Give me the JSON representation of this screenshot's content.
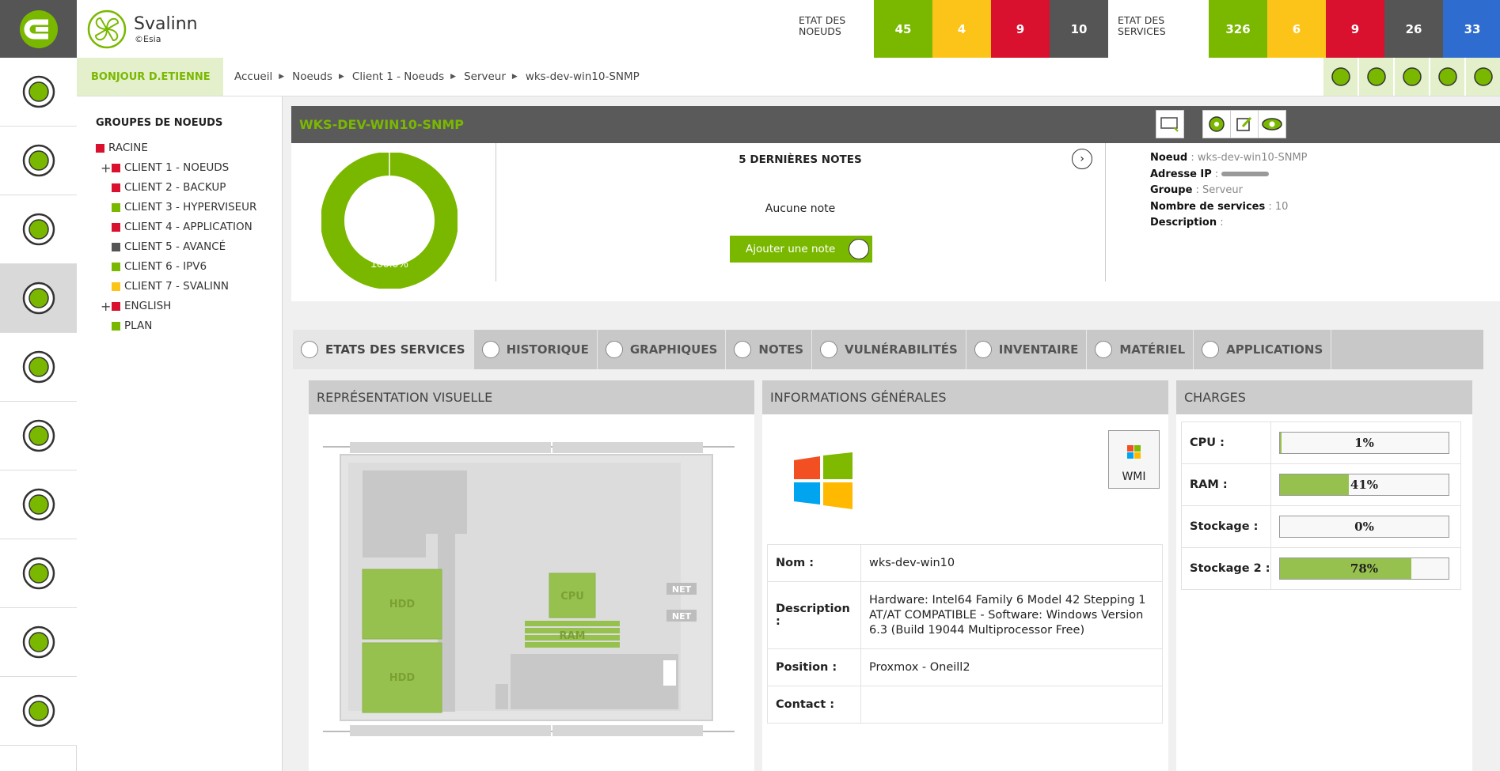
{
  "brand": {
    "name": "Svalinn",
    "sub": "©Esia"
  },
  "node_status": {
    "label": "ETAT DES NOEUDS",
    "counts": [
      {
        "value": "45",
        "color": "#7ab800"
      },
      {
        "value": "4",
        "color": "#fcc419"
      },
      {
        "value": "9",
        "color": "#d9102e"
      },
      {
        "value": "10",
        "color": "#555555"
      }
    ]
  },
  "service_status": {
    "label": "ETAT DES SERVICES",
    "counts": [
      {
        "value": "326",
        "color": "#7ab800"
      },
      {
        "value": "6",
        "color": "#fcc419"
      },
      {
        "value": "9",
        "color": "#d9102e"
      },
      {
        "value": "26",
        "color": "#555555"
      },
      {
        "value": "33",
        "color": "#2f6ccf"
      }
    ]
  },
  "greeting": "BONJOUR D.ETIENNE",
  "breadcrumb": [
    "Accueil",
    "Noeuds",
    "Client 1 - Noeuds",
    "Serveur",
    "wks-dev-win10-SNMP"
  ],
  "toolbar_icons": [
    "user-icon",
    "rss-icon",
    "search-icon",
    "help-icon",
    "lock-icon"
  ],
  "left_nav": [
    "dashboard-icon",
    "alert-icon",
    "history-icon",
    "share-nodes-icon",
    "report-icon",
    "satellite-icon",
    "security-icon",
    "workflow-icon",
    "layers-icon",
    "settings-icon"
  ],
  "groups": {
    "title": "GROUPES DE NOEUDS",
    "items": [
      {
        "label": "RACINE",
        "color": "#d9102e",
        "indent": 0,
        "expand": ""
      },
      {
        "label": "CLIENT 1 - NOEUDS",
        "color": "#d9102e",
        "indent": 1,
        "expand": "+"
      },
      {
        "label": "CLIENT 2 - BACKUP",
        "color": "#d9102e",
        "indent": 1,
        "expand": ""
      },
      {
        "label": "CLIENT 3 - HYPERVISEUR",
        "color": "#7ab800",
        "indent": 1,
        "expand": ""
      },
      {
        "label": "CLIENT 4 - APPLICATION",
        "color": "#d9102e",
        "indent": 1,
        "expand": ""
      },
      {
        "label": "CLIENT 5 - AVANCÉ",
        "color": "#555555",
        "indent": 1,
        "expand": ""
      },
      {
        "label": "CLIENT 6 - IPV6",
        "color": "#7ab800",
        "indent": 1,
        "expand": ""
      },
      {
        "label": "CLIENT 7 - SVALINN",
        "color": "#fcc419",
        "indent": 1,
        "expand": ""
      },
      {
        "label": "ENGLISH",
        "color": "#d9102e",
        "indent": 1,
        "expand": "+"
      },
      {
        "label": "PLAN",
        "color": "#7ab800",
        "indent": 1,
        "expand": ""
      }
    ]
  },
  "node": {
    "title": "WKS-DEV-WIN10-SNMP",
    "availability": 100.0,
    "availability_label": "100.0%",
    "notes_title": "5 DERNIÈRES NOTES",
    "notes_empty": "Aucune note",
    "add_note": "Ajouter une note",
    "info": [
      {
        "key": "Noeud",
        "value": "wks-dev-win10-SNMP"
      },
      {
        "key": "Adresse IP",
        "value": ""
      },
      {
        "key": "Groupe",
        "value": "Serveur"
      },
      {
        "key": "Nombre de services",
        "value": "10"
      },
      {
        "key": "Description",
        "value": ""
      }
    ]
  },
  "tabs": [
    {
      "label": "ETATS DES SERVICES",
      "active": true
    },
    {
      "label": "HISTORIQUE",
      "active": false
    },
    {
      "label": "GRAPHIQUES",
      "active": false
    },
    {
      "label": "NOTES",
      "active": false
    },
    {
      "label": "VULNÉRABILITÉS",
      "active": false
    },
    {
      "label": "INVENTAIRE",
      "active": false
    },
    {
      "label": "MATÉRIEL",
      "active": false
    },
    {
      "label": "APPLICATIONS",
      "active": false
    }
  ],
  "visual": {
    "title": "REPRÉSENTATION VISUELLE",
    "hdd1": "HDD",
    "hdd2": "HDD",
    "cpu": "CPU",
    "ram": "RAM",
    "net1": "NET",
    "net2": "NET"
  },
  "general": {
    "title": "INFORMATIONS GÉNÉRALES",
    "wmi": "WMI",
    "rows": [
      {
        "key": "Nom :",
        "value": "wks-dev-win10"
      },
      {
        "key": "Description :",
        "value": "Hardware: Intel64 Family 6 Model 42 Stepping 1 AT/AT COMPATIBLE - Software: Windows Version 6.3 (Build 19044 Multiprocessor Free)"
      },
      {
        "key": "Position :",
        "value": "Proxmox - Oneill2"
      },
      {
        "key": "Contact :",
        "value": ""
      }
    ]
  },
  "charges": {
    "title": "CHARGES",
    "rows": [
      {
        "key": "CPU :",
        "percent": 1,
        "label": "1%"
      },
      {
        "key": "RAM :",
        "percent": 41,
        "label": "41%"
      },
      {
        "key": "Stockage :",
        "percent": 0,
        "label": "0%"
      },
      {
        "key": "Stockage 2 :",
        "percent": 78,
        "label": "78%"
      }
    ]
  }
}
